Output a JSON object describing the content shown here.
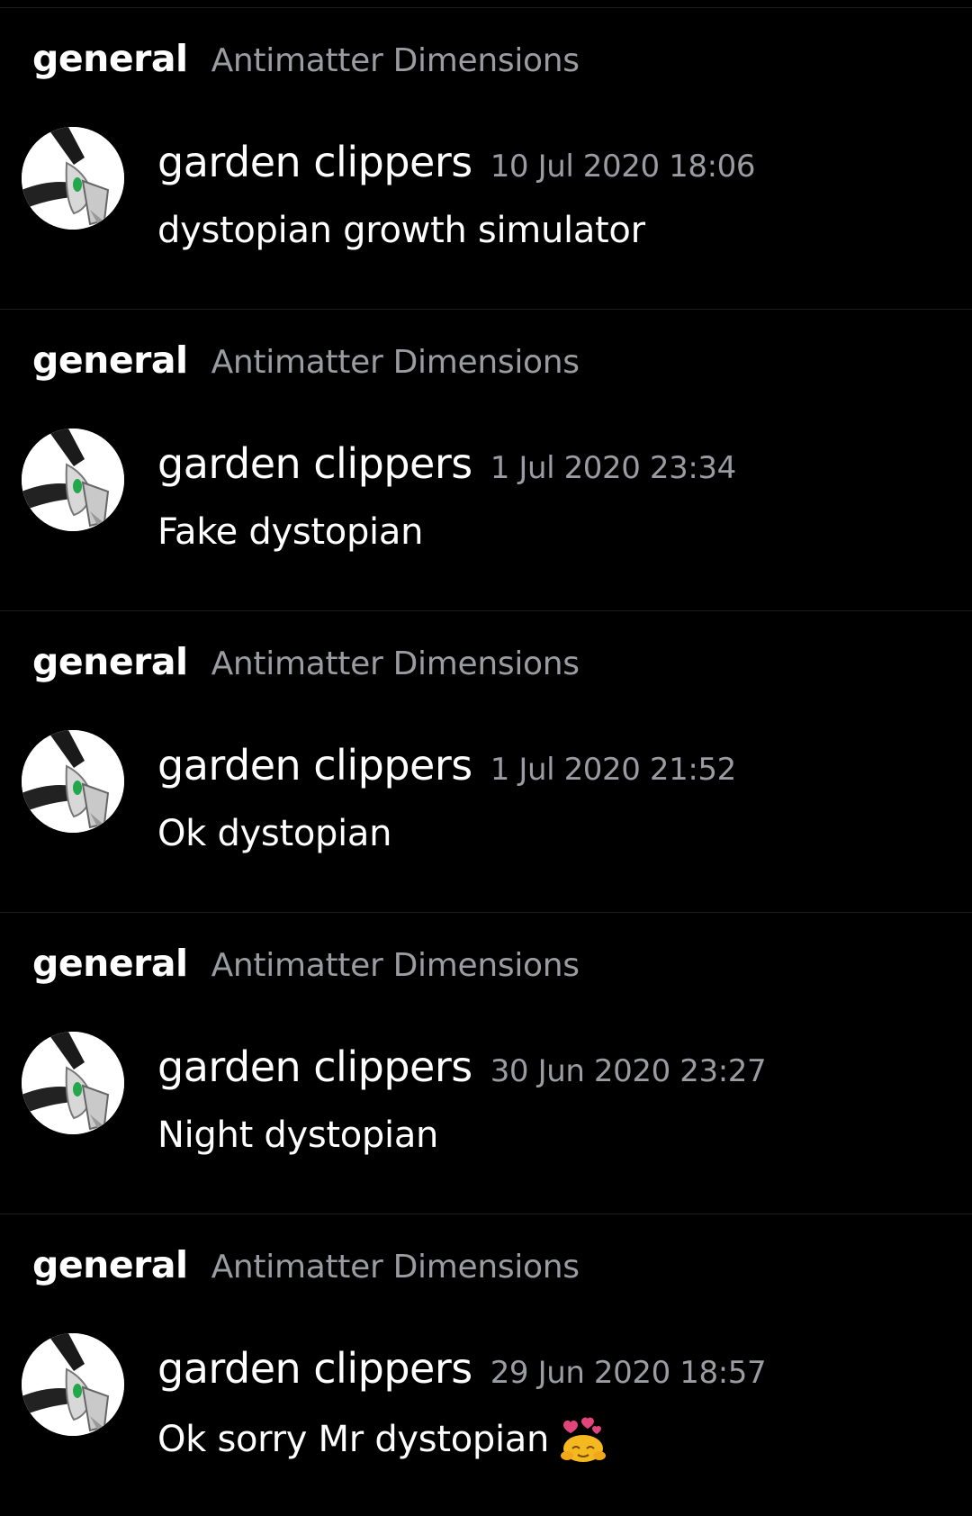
{
  "results": [
    {
      "channel": "general",
      "guild": "Antimatter Dimensions",
      "author": "garden clippers",
      "timestamp": "10 Jul 2020 18:06",
      "content": "dystopian growth simulator",
      "emoji": null
    },
    {
      "channel": "general",
      "guild": "Antimatter Dimensions",
      "author": "garden clippers",
      "timestamp": "1 Jul 2020 23:34",
      "content": "Fake dystopian",
      "emoji": null
    },
    {
      "channel": "general",
      "guild": "Antimatter Dimensions",
      "author": "garden clippers",
      "timestamp": "1 Jul 2020 21:52",
      "content": "Ok dystopian",
      "emoji": null
    },
    {
      "channel": "general",
      "guild": "Antimatter Dimensions",
      "author": "garden clippers",
      "timestamp": "30 Jun 2020 23:27",
      "content": "Night dystopian",
      "emoji": null
    },
    {
      "channel": "general",
      "guild": "Antimatter Dimensions",
      "author": "garden clippers",
      "timestamp": "29 Jun 2020 18:57",
      "content": "Ok sorry Mr dystopian",
      "emoji": "hugging-hearts-emoji"
    }
  ],
  "colors": {
    "background": "#000000",
    "divider": "#1c1c1e",
    "primary_text": "#ffffff",
    "muted_text": "#9b9ca1"
  }
}
